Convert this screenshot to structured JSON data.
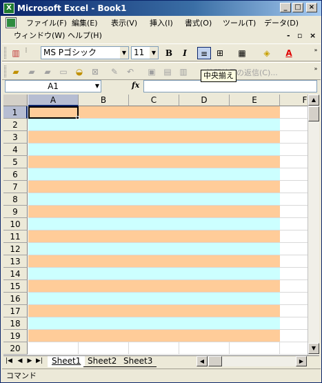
{
  "window": {
    "title": "Microsoft Excel - Book1",
    "app_icon": "excel-icon"
  },
  "menubar": {
    "items": [
      "ファイル(F)",
      "編集(E)",
      "表示(V)",
      "挿入(I)",
      "書式(O)",
      "ツール(T)",
      "データ(D)",
      "ウィンドウ(W)",
      "ヘルプ(H)"
    ]
  },
  "formatting_toolbar": {
    "font_name": "MS Pゴシック",
    "font_size": "11",
    "bold_label": "B",
    "italic_label": "I"
  },
  "tooltip": {
    "text": "中央揃え"
  },
  "review_toolbar": {
    "reply_label": "校閲結果の返信(C)..."
  },
  "formula_bar": {
    "name_box": "A1",
    "fx_label": "fx",
    "formula": ""
  },
  "grid": {
    "columns": [
      "A",
      "B",
      "C",
      "D",
      "E",
      "F"
    ],
    "rows": [
      "1",
      "2",
      "3",
      "4",
      "5",
      "6",
      "7",
      "8",
      "9",
      "10",
      "11",
      "12",
      "13",
      "14",
      "15",
      "16",
      "17",
      "18",
      "19",
      "20"
    ],
    "selected_cell": "A1",
    "band_colors": {
      "odd": "#ffcc99",
      "even": "#ccffff"
    },
    "banded_rows": 19,
    "banded_columns": [
      "A",
      "B",
      "C",
      "D",
      "E"
    ]
  },
  "sheets": {
    "tabs": [
      "Sheet1",
      "Sheet2",
      "Sheet3"
    ],
    "active": "Sheet1"
  },
  "statusbar": {
    "text": "コマンド"
  }
}
